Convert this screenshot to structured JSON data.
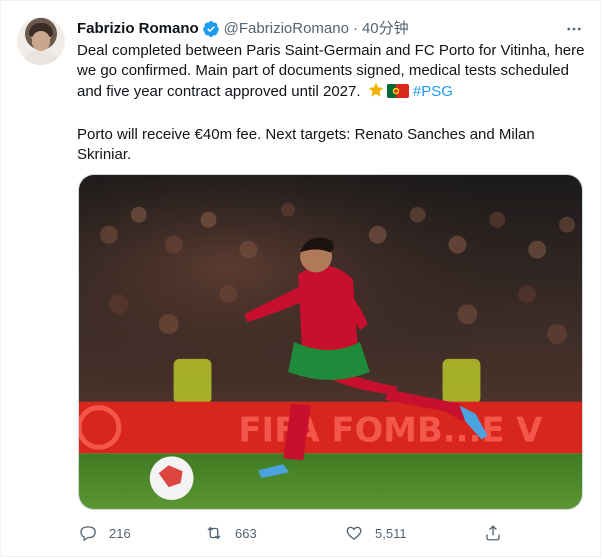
{
  "tweet": {
    "display_name": "Fabrizio Romano",
    "handle": "@FabrizioRomano",
    "separator": "·",
    "time": "40分钟",
    "text_line1": "Deal completed between Paris Saint-Germain and FC Porto for Vitinha, here we go confirmed. Main part of documents signed, medical tests scheduled and five year contract approved until 2027.",
    "hashtag": "#PSG",
    "text_line2": "Porto will receive €40m fee. Next targets: Renato Sanches and Milan Skriniar.",
    "emojis": [
      "star",
      "portugal-flag"
    ]
  },
  "media": {
    "description_colors": {
      "pitch": "#4f8a2a",
      "board": "#d9261c",
      "shirt": "#c8102e",
      "shorts": "#1f8a3a"
    },
    "board_text": "FIFA FOMB...E V"
  },
  "actions": {
    "replies": "216",
    "retweets": "663",
    "likes": "5,511"
  },
  "colors": {
    "accent": "#1d9bf0",
    "muted": "#536471",
    "text": "#0f1419"
  }
}
